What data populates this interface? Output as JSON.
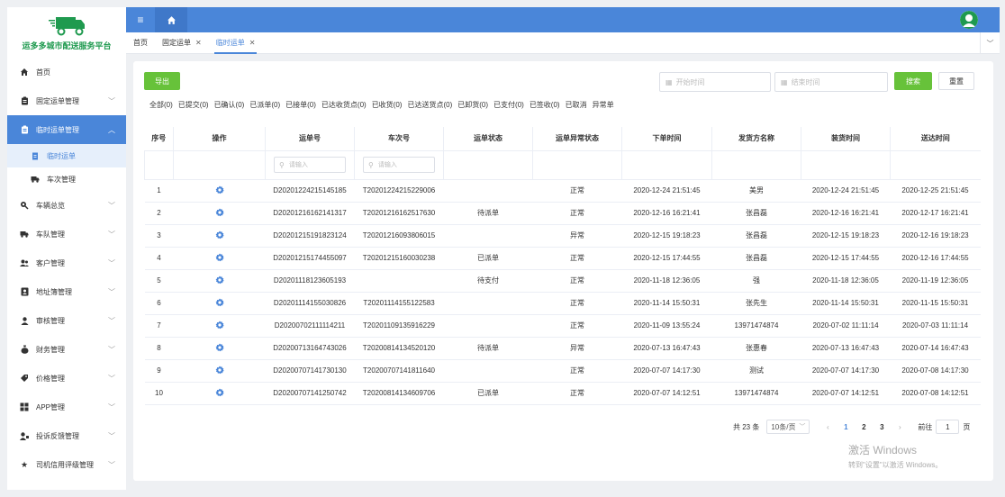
{
  "app": {
    "logo_text": "运多多城市配送服务平台",
    "brand_color": "#4a86d9",
    "accent_green": "#67c23a"
  },
  "sidebar": {
    "items": [
      {
        "label": "首页",
        "icon": "home-icon",
        "has_children": false
      },
      {
        "label": "固定运单管理",
        "icon": "clipboard-icon",
        "has_children": true
      },
      {
        "label": "临时运单管理",
        "icon": "clipboard-icon",
        "has_children": true,
        "expanded": true,
        "active": true
      },
      {
        "label": "车辆总览",
        "icon": "location-pin-icon",
        "has_children": true
      },
      {
        "label": "车队管理",
        "icon": "truck-icon",
        "has_children": true
      },
      {
        "label": "客户管理",
        "icon": "users-icon",
        "has_children": true
      },
      {
        "label": "地址簿管理",
        "icon": "address-book-icon",
        "has_children": true
      },
      {
        "label": "审核管理",
        "icon": "user-icon",
        "has_children": true
      },
      {
        "label": "财务管理",
        "icon": "money-bag-icon",
        "has_children": true
      },
      {
        "label": "价格管理",
        "icon": "tag-icon",
        "has_children": true
      },
      {
        "label": "APP管理",
        "icon": "grid-icon",
        "has_children": true
      },
      {
        "label": "投诉反馈管理",
        "icon": "user-feedback-icon",
        "has_children": true
      },
      {
        "label": "司机信用评级管理",
        "icon": "star-icon",
        "has_children": true
      }
    ],
    "sub_items": [
      {
        "label": "临时运单",
        "icon": "document-icon",
        "active": true
      },
      {
        "label": "车次管理",
        "icon": "truck-icon",
        "active": false
      }
    ]
  },
  "tabs": [
    {
      "label": "首页",
      "closable": false
    },
    {
      "label": "固定运单",
      "closable": true
    },
    {
      "label": "临时运单",
      "closable": true,
      "active": true
    }
  ],
  "toolbar": {
    "export_label": "导出",
    "start_placeholder": "开始时间",
    "end_placeholder": "结束时间",
    "search_label": "搜索",
    "reset_label": "重置"
  },
  "filters": [
    "全部(0)",
    "已提交(0)",
    "已确认(0)",
    "已派单(0)",
    "已接单(0)",
    "已达收货点(0)",
    "已收货(0)",
    "已达送货点(0)",
    "已卸货(0)",
    "已支付(0)",
    "已签收(0)",
    "已取消",
    "异常单"
  ],
  "table": {
    "columns": [
      "序号",
      "操作",
      "运单号",
      "车次号",
      "运单状态",
      "运单异常状态",
      "下单时间",
      "发货方名称",
      "装货时间",
      "送达时间"
    ],
    "search_placeholder": "请输入",
    "rows": [
      {
        "no": "1",
        "order": "D20201224215145185",
        "trip": "T20201224215229006",
        "status": "",
        "abnormal": "正常",
        "order_time": "2020-12-24 21:51:45",
        "shipper": "美男",
        "load_time": "2020-12-24 21:51:45",
        "deliver_time": "2020-12-25 21:51:45"
      },
      {
        "no": "2",
        "order": "D20201216162141317",
        "trip": "T20201216162517630",
        "status": "待派单",
        "abnormal": "正常",
        "order_time": "2020-12-16 16:21:41",
        "shipper": "张昌磊",
        "load_time": "2020-12-16 16:21:41",
        "deliver_time": "2020-12-17 16:21:41"
      },
      {
        "no": "3",
        "order": "D20201215191823124",
        "trip": "T20201216093806015",
        "status": "",
        "abnormal": "异常",
        "order_time": "2020-12-15 19:18:23",
        "shipper": "张昌磊",
        "load_time": "2020-12-15 19:18:23",
        "deliver_time": "2020-12-16 19:18:23"
      },
      {
        "no": "4",
        "order": "D20201215174455097",
        "trip": "T20201215160030238",
        "status": "已派单",
        "abnormal": "正常",
        "order_time": "2020-12-15 17:44:55",
        "shipper": "张昌磊",
        "load_time": "2020-12-15 17:44:55",
        "deliver_time": "2020-12-16 17:44:55"
      },
      {
        "no": "5",
        "order": "D20201118123605193",
        "trip": "",
        "status": "待支付",
        "abnormal": "正常",
        "order_time": "2020-11-18 12:36:05",
        "shipper": "强",
        "load_time": "2020-11-18 12:36:05",
        "deliver_time": "2020-11-19 12:36:05"
      },
      {
        "no": "6",
        "order": "D20201114155030826",
        "trip": "T20201114155122583",
        "status": "",
        "abnormal": "正常",
        "order_time": "2020-11-14 15:50:31",
        "shipper": "张先生",
        "load_time": "2020-11-14 15:50:31",
        "deliver_time": "2020-11-15 15:50:31"
      },
      {
        "no": "7",
        "order": "D20200702111114211",
        "trip": "T20201109135916229",
        "status": "",
        "abnormal": "正常",
        "order_time": "2020-11-09 13:55:24",
        "shipper": "13971474874",
        "load_time": "2020-07-02 11:11:14",
        "deliver_time": "2020-07-03 11:11:14"
      },
      {
        "no": "8",
        "order": "D20200713164743026",
        "trip": "T20200814134520120",
        "status": "待派单",
        "abnormal": "异常",
        "order_time": "2020-07-13 16:47:43",
        "shipper": "张惠春",
        "load_time": "2020-07-13 16:47:43",
        "deliver_time": "2020-07-14 16:47:43"
      },
      {
        "no": "9",
        "order": "D20200707141730130",
        "trip": "T20200707141811640",
        "status": "",
        "abnormal": "正常",
        "order_time": "2020-07-07 14:17:30",
        "shipper": "测试",
        "load_time": "2020-07-07 14:17:30",
        "deliver_time": "2020-07-08 14:17:30"
      },
      {
        "no": "10",
        "order": "D20200707141250742",
        "trip": "T20200814134609706",
        "status": "已派单",
        "abnormal": "正常",
        "order_time": "2020-07-07 14:12:51",
        "shipper": "13971474874",
        "load_time": "2020-07-07 14:12:51",
        "deliver_time": "2020-07-08 14:12:51"
      }
    ]
  },
  "pagination": {
    "total_label": "共 23 条",
    "page_size_label": "10条/页",
    "pages": [
      "1",
      "2",
      "3"
    ],
    "current": "1",
    "goto_label": "前往",
    "goto_value": "1",
    "page_unit": "页"
  },
  "watermark": {
    "line1": "激活 Windows",
    "line2": "转到\"设置\"以激活 Windows。"
  }
}
